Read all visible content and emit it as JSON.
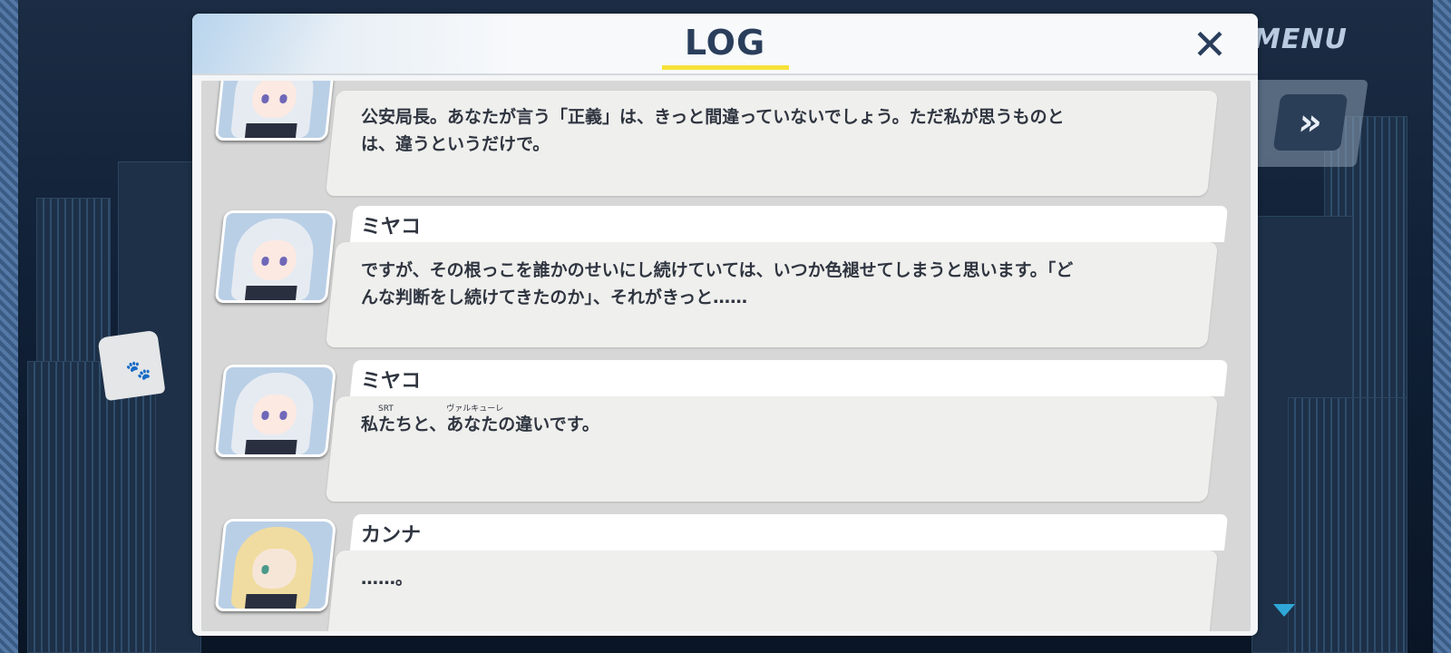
{
  "hud": {
    "menu_label": "MENU",
    "fast_forward_icon": "»"
  },
  "log": {
    "title": "LOG",
    "close_icon": "✕",
    "entries": [
      {
        "speaker": "",
        "portrait": "miyako-portrait",
        "lines": [
          "公安局長。あなたが言う「正義」は、きっと間違っていないでしょう。ただ私が思うものと",
          "は、違うというだけで。"
        ]
      },
      {
        "speaker": "ミヤコ",
        "portrait": "miyako-portrait",
        "lines": [
          "ですが、その根っこを誰かのせいにし続けていては、いつか色褪せてしまうと思います。「ど",
          "んな判断をし続けてきたのか」、それがきっと……"
        ]
      },
      {
        "speaker": "ミヤコ",
        "portrait": "miyako-portrait",
        "segments": [
          "私",
          "たち",
          "と、",
          "あなた",
          "の違いです。"
        ],
        "ruby": [
          "SRT",
          "ヴァルキューレ"
        ]
      },
      {
        "speaker": "カンナ",
        "portrait": "kanna-portrait",
        "lines": [
          "……。"
        ]
      }
    ]
  }
}
